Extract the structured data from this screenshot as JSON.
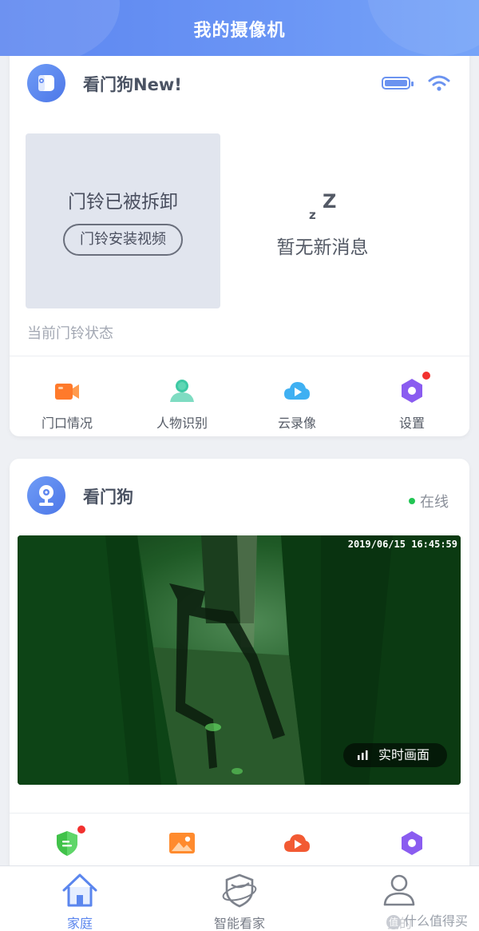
{
  "header": {
    "title": "我的摄像机"
  },
  "doorbell": {
    "name": "看门狗New!",
    "detached_text": "门铃已被拆卸",
    "install_video_label": "门铃安装视频",
    "zz_big": "Z",
    "zz_small": "z",
    "no_message": "暂无新消息",
    "state_label": "当前门铃状态",
    "actions": [
      {
        "label": "门口情况",
        "icon": "door-camera-icon"
      },
      {
        "label": "人物识别",
        "icon": "person-icon"
      },
      {
        "label": "云录像",
        "icon": "cloud-play-icon"
      },
      {
        "label": "设置",
        "icon": "settings-hex-icon"
      }
    ]
  },
  "camera": {
    "name": "看门狗",
    "status": "在线",
    "timestamp": "2019/06/15 16:45:59",
    "live_label": "实时画面",
    "actions": [
      {
        "icon": "shield-icon"
      },
      {
        "icon": "image-icon"
      },
      {
        "icon": "cloud-play-icon"
      },
      {
        "icon": "settings-hex-icon"
      }
    ]
  },
  "bottom_nav": {
    "items": [
      {
        "label": "家庭",
        "icon": "home-icon",
        "active": true
      },
      {
        "label": "智能看家",
        "icon": "shield-guard-icon",
        "active": false
      },
      {
        "label": "我的",
        "icon": "user-icon",
        "active": false
      }
    ]
  },
  "watermark": {
    "text": "什么值得买",
    "badge": "值"
  },
  "colors": {
    "accent": "#5b86ee",
    "online": "#22c554",
    "badge_red": "#f2312f"
  }
}
